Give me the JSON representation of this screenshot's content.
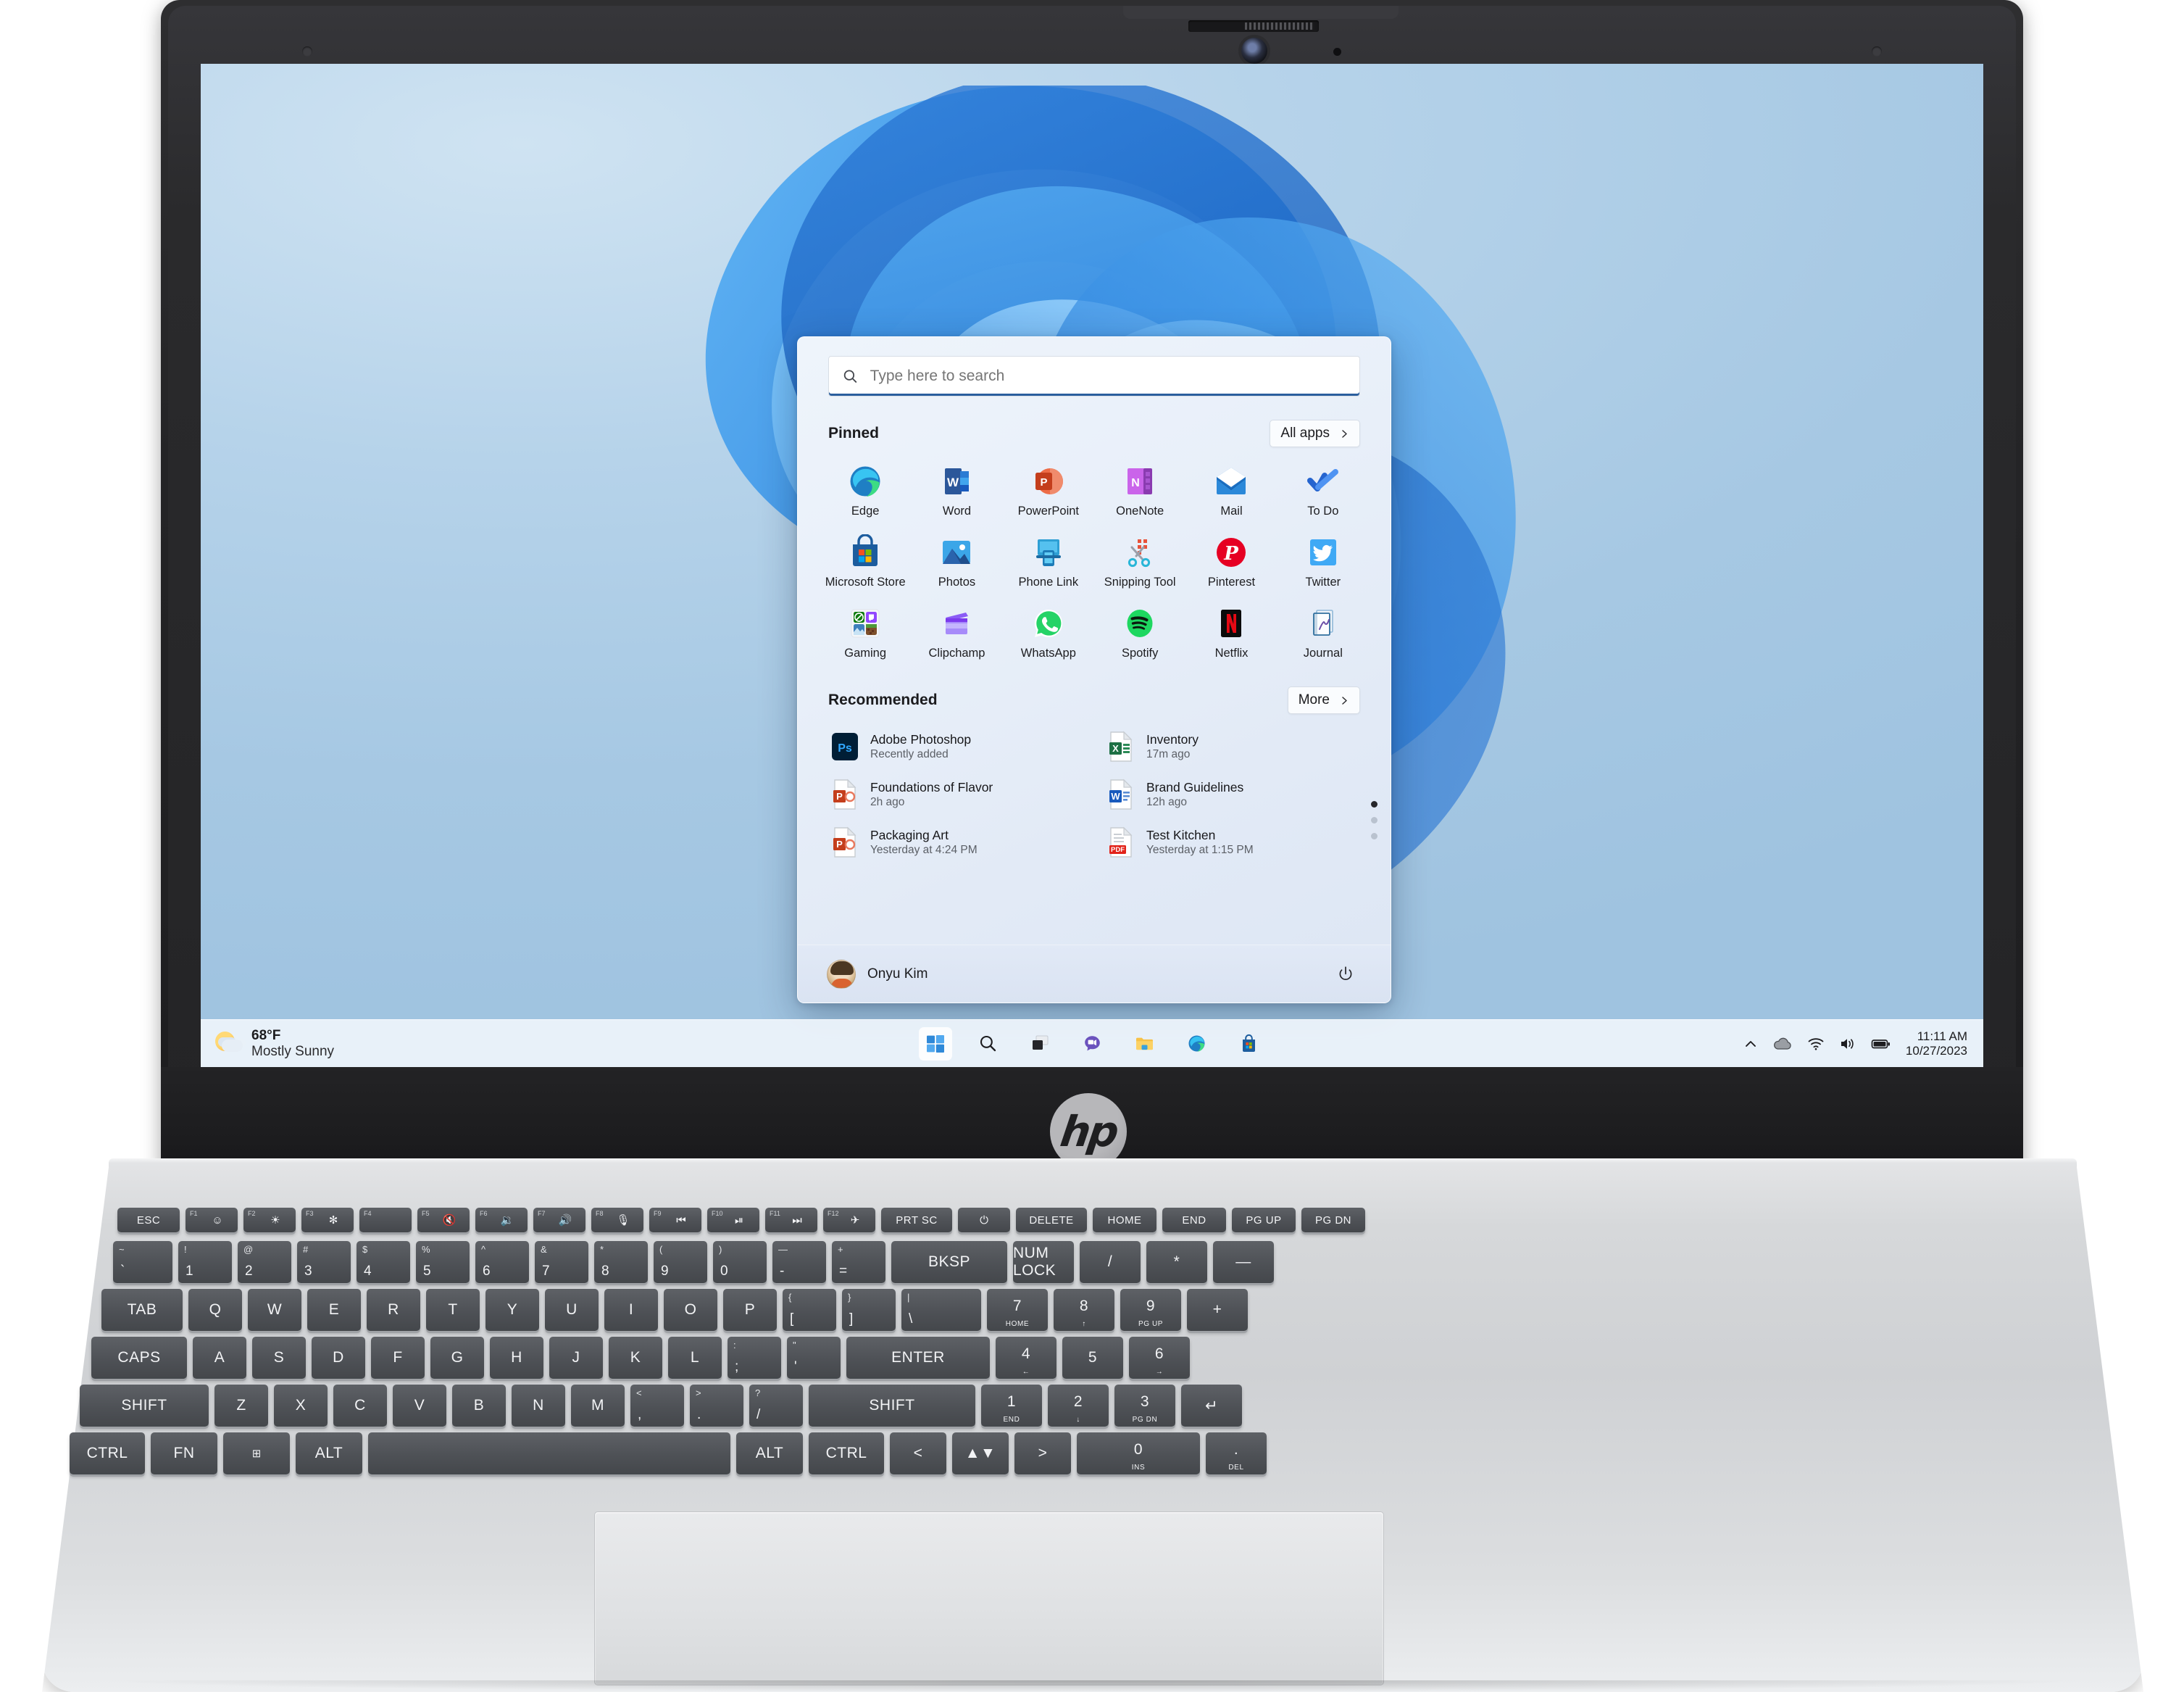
{
  "device": {
    "brand": "hp",
    "brand_label": "hp"
  },
  "desktop": {
    "wallpaper_name": "windows-11-bloom-light"
  },
  "start_menu": {
    "search": {
      "placeholder": "Type here to search",
      "value": "",
      "icon": "search-icon"
    },
    "pinned": {
      "title": "Pinned",
      "all_apps_label": "All apps",
      "all_apps_icon": "chevron-right-icon",
      "apps": [
        {
          "label": "Edge",
          "icon": "edge-icon"
        },
        {
          "label": "Word",
          "icon": "word-icon"
        },
        {
          "label": "PowerPoint",
          "icon": "powerpoint-icon"
        },
        {
          "label": "OneNote",
          "icon": "onenote-icon"
        },
        {
          "label": "Mail",
          "icon": "mail-icon"
        },
        {
          "label": "To Do",
          "icon": "todo-icon"
        },
        {
          "label": "Microsoft Store",
          "icon": "microsoft-store-icon"
        },
        {
          "label": "Photos",
          "icon": "photos-icon"
        },
        {
          "label": "Phone Link",
          "icon": "phone-link-icon"
        },
        {
          "label": "Snipping Tool",
          "icon": "snipping-tool-icon"
        },
        {
          "label": "Pinterest",
          "icon": "pinterest-icon"
        },
        {
          "label": "Twitter",
          "icon": "twitter-icon"
        },
        {
          "label": "Gaming",
          "icon": "gaming-folder-icon"
        },
        {
          "label": "Clipchamp",
          "icon": "clipchamp-icon"
        },
        {
          "label": "WhatsApp",
          "icon": "whatsapp-icon"
        },
        {
          "label": "Spotify",
          "icon": "spotify-icon"
        },
        {
          "label": "Netflix",
          "icon": "netflix-icon"
        },
        {
          "label": "Journal",
          "icon": "journal-icon"
        }
      ],
      "page_count": 3,
      "active_page": 1
    },
    "recommended": {
      "title": "Recommended",
      "more_label": "More",
      "more_icon": "chevron-right-icon",
      "items": [
        {
          "name": "Adobe Photoshop",
          "subtitle": "Recently added",
          "icon": "photoshop-icon"
        },
        {
          "name": "Inventory",
          "subtitle": "17m ago",
          "icon": "excel-file-icon"
        },
        {
          "name": "Foundations of Flavor",
          "subtitle": "2h ago",
          "icon": "powerpoint-file-icon"
        },
        {
          "name": "Brand Guidelines",
          "subtitle": "12h ago",
          "icon": "word-file-icon"
        },
        {
          "name": "Packaging Art",
          "subtitle": "Yesterday at 4:24 PM",
          "icon": "powerpoint-file-icon"
        },
        {
          "name": "Test Kitchen",
          "subtitle": "Yesterday at 1:15 PM",
          "icon": "pdf-file-icon"
        }
      ]
    },
    "footer": {
      "user_name": "Onyu Kim",
      "avatar_icon": "user-avatar",
      "power_label": "",
      "power_icon": "power-icon"
    }
  },
  "taskbar": {
    "weather": {
      "temperature": "68°F",
      "condition": "Mostly Sunny",
      "icon": "sun-cloud-icon"
    },
    "buttons": [
      {
        "name": "start",
        "icon": "windows-start-icon",
        "active": true
      },
      {
        "name": "search",
        "icon": "search-icon",
        "active": false
      },
      {
        "name": "task-view",
        "icon": "task-view-icon",
        "active": false
      },
      {
        "name": "chat",
        "icon": "chat-teams-icon",
        "active": false
      },
      {
        "name": "file-explorer",
        "icon": "folder-icon",
        "active": false
      },
      {
        "name": "edge",
        "icon": "edge-icon",
        "active": false
      },
      {
        "name": "microsoft-store",
        "icon": "microsoft-store-icon",
        "active": false
      }
    ],
    "tray": {
      "overflow_icon": "chevron-up-icon",
      "onedrive_icon": "cloud-icon",
      "wifi_icon": "wifi-icon",
      "volume_icon": "speaker-icon",
      "battery_icon": "battery-icon",
      "time": "11:11 AM",
      "date": "10/27/2023"
    }
  },
  "keyboard": {
    "fn_row": [
      {
        "label": "ESC"
      },
      {
        "fn": "F1",
        "glyph": "☺"
      },
      {
        "fn": "F2",
        "glyph": "☀"
      },
      {
        "fn": "F3",
        "glyph": "✻"
      },
      {
        "fn": "F4",
        "glyph": ""
      },
      {
        "fn": "F5",
        "glyph": "🔇"
      },
      {
        "fn": "F6",
        "glyph": "🔉"
      },
      {
        "fn": "F7",
        "glyph": "🔊"
      },
      {
        "fn": "F8",
        "glyph": "🎙"
      },
      {
        "fn": "F9",
        "glyph": "⏮"
      },
      {
        "fn": "F10",
        "glyph": "⏯"
      },
      {
        "fn": "F11",
        "glyph": "⏭"
      },
      {
        "fn": "F12",
        "glyph": "✈"
      },
      {
        "label": "PRT SC"
      },
      {
        "glyph": "⏻"
      },
      {
        "label": "DELETE"
      },
      {
        "label": "HOME"
      },
      {
        "label": "END"
      },
      {
        "label": "PG UP"
      },
      {
        "label": "PG DN"
      }
    ],
    "number_row": [
      {
        "top": "~",
        "bottom": "`"
      },
      {
        "top": "!",
        "bottom": "1"
      },
      {
        "top": "@",
        "bottom": "2"
      },
      {
        "top": "#",
        "bottom": "3"
      },
      {
        "top": "$",
        "bottom": "4"
      },
      {
        "top": "%",
        "bottom": "5"
      },
      {
        "top": "^",
        "bottom": "6"
      },
      {
        "top": "&",
        "bottom": "7"
      },
      {
        "top": "*",
        "bottom": "8"
      },
      {
        "top": "(",
        "bottom": "9"
      },
      {
        "top": ")",
        "bottom": "0"
      },
      {
        "top": "—",
        "bottom": "-"
      },
      {
        "top": "+",
        "bottom": "="
      },
      {
        "label": "BKSP"
      },
      {
        "label": "NUM LOCK"
      },
      {
        "label": "/"
      },
      {
        "label": "*"
      },
      {
        "label": "—"
      }
    ],
    "row_q": [
      {
        "label": "TAB"
      },
      {
        "label": "Q"
      },
      {
        "label": "W"
      },
      {
        "label": "E"
      },
      {
        "label": "R"
      },
      {
        "label": "T"
      },
      {
        "label": "Y"
      },
      {
        "label": "U"
      },
      {
        "label": "I"
      },
      {
        "label": "O"
      },
      {
        "label": "P"
      },
      {
        "top": "{",
        "bottom": "["
      },
      {
        "top": "}",
        "bottom": "]"
      },
      {
        "top": "|",
        "bottom": "\\"
      },
      {
        "label": "7",
        "sub": "HOME"
      },
      {
        "label": "8",
        "sub": "↑"
      },
      {
        "label": "9",
        "sub": "PG UP"
      },
      {
        "label": "+"
      }
    ],
    "row_a": [
      {
        "label": "CAPS"
      },
      {
        "label": "A"
      },
      {
        "label": "S"
      },
      {
        "label": "D"
      },
      {
        "label": "F"
      },
      {
        "label": "G"
      },
      {
        "label": "H"
      },
      {
        "label": "J"
      },
      {
        "label": "K"
      },
      {
        "label": "L"
      },
      {
        "top": ":",
        "bottom": ";"
      },
      {
        "top": "\"",
        "bottom": "'"
      },
      {
        "label": "ENTER"
      },
      {
        "label": "4",
        "sub": "←"
      },
      {
        "label": "5",
        "sub": ""
      },
      {
        "label": "6",
        "sub": "→"
      }
    ],
    "row_z": [
      {
        "label": "SHIFT"
      },
      {
        "label": "Z"
      },
      {
        "label": "X"
      },
      {
        "label": "C"
      },
      {
        "label": "V"
      },
      {
        "label": "B"
      },
      {
        "label": "N"
      },
      {
        "label": "M"
      },
      {
        "top": "<",
        "bottom": ","
      },
      {
        "top": ">",
        "bottom": "."
      },
      {
        "top": "?",
        "bottom": "/"
      },
      {
        "label": "SHIFT"
      },
      {
        "label": "1",
        "sub": "END"
      },
      {
        "label": "2",
        "sub": "↓"
      },
      {
        "label": "3",
        "sub": "PG DN"
      },
      {
        "label": "↵"
      }
    ],
    "row_ctrl": [
      {
        "label": "CTRL"
      },
      {
        "label": "FN"
      },
      {
        "glyph": "⊞"
      },
      {
        "label": "ALT"
      },
      {
        "label": ""
      },
      {
        "label": "ALT"
      },
      {
        "label": "CTRL"
      },
      {
        "label": "<"
      },
      {
        "label": "▲▼"
      },
      {
        "label": ">"
      },
      {
        "label": "0",
        "sub": "INS"
      },
      {
        "label": ".",
        "sub": "DEL"
      }
    ]
  }
}
